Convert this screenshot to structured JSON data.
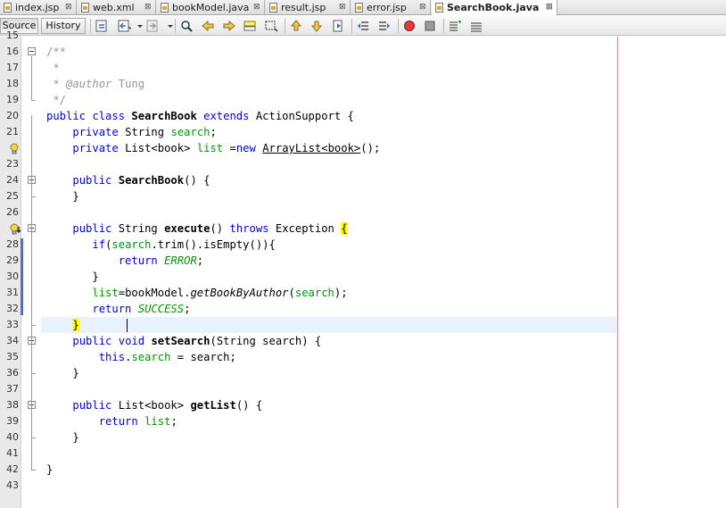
{
  "tabs": [
    {
      "label": "index.jsp",
      "active": false
    },
    {
      "label": "web.xml",
      "active": false
    },
    {
      "label": "bookModel.java",
      "active": false
    },
    {
      "label": "result.jsp",
      "active": false
    },
    {
      "label": "error.jsp",
      "active": false
    },
    {
      "label": "SearchBook.java",
      "active": true
    }
  ],
  "tab_close_glyph": "⊠",
  "toolbar": {
    "source_label": "Source",
    "history_label": "History",
    "icons": [
      "last-edit-icon",
      "back-icon",
      "forward-icon",
      "find-selection-icon",
      "find-previous-icon",
      "find-next-icon",
      "toggle-highlight-icon",
      "toggle-rectangular-selection-icon",
      "previous-bookmark-icon",
      "next-bookmark-icon",
      "toggle-bookmark-icon",
      "shift-left-icon",
      "shift-right-icon",
      "start-macro-icon",
      "stop-macro-icon",
      "comment-icon",
      "uncomment-icon"
    ]
  },
  "colors": {
    "keyword": "#0000e6",
    "field": "#009900",
    "comment": "#969696",
    "match_highlight": "#ffff00",
    "current_line": "#e8f2fe",
    "margin_line": "#f08a8a"
  },
  "editor": {
    "lines": [
      {
        "n": "15",
        "text": ""
      },
      {
        "n": "16",
        "text": "/**"
      },
      {
        "n": "17",
        "text": " *"
      },
      {
        "n": "18",
        "text": " * @author Tung"
      },
      {
        "n": "19",
        "text": " */"
      },
      {
        "n": "20",
        "text": "public class SearchBook extends ActionSupport {"
      },
      {
        "n": "21",
        "text": "    private String search;"
      },
      {
        "n": "",
        "text": "    private List<book> list =new ArrayList<book>();"
      },
      {
        "n": "23",
        "text": ""
      },
      {
        "n": "24",
        "text": "    public SearchBook() {"
      },
      {
        "n": "25",
        "text": "    }"
      },
      {
        "n": "26",
        "text": ""
      },
      {
        "n": "",
        "text": "    public String execute() throws Exception {"
      },
      {
        "n": "28",
        "text": "       if(search.trim().isEmpty()){"
      },
      {
        "n": "29",
        "text": "           return ERROR;"
      },
      {
        "n": "30",
        "text": "       }"
      },
      {
        "n": "31",
        "text": "       list=bookModel.getBookByAuthor(search);"
      },
      {
        "n": "32",
        "text": "       return SUCCESS;"
      },
      {
        "n": "33",
        "text": "    }"
      },
      {
        "n": "34",
        "text": "    public void setSearch(String search) {"
      },
      {
        "n": "35",
        "text": "        this.search = search;"
      },
      {
        "n": "36",
        "text": "    }"
      },
      {
        "n": "37",
        "text": ""
      },
      {
        "n": "38",
        "text": "    public List<book> getList() {"
      },
      {
        "n": "39",
        "text": "        return list;"
      },
      {
        "n": "40",
        "text": "    }"
      },
      {
        "n": "41",
        "text": ""
      },
      {
        "n": "42",
        "text": "}"
      },
      {
        "n": "43",
        "text": ""
      }
    ]
  }
}
